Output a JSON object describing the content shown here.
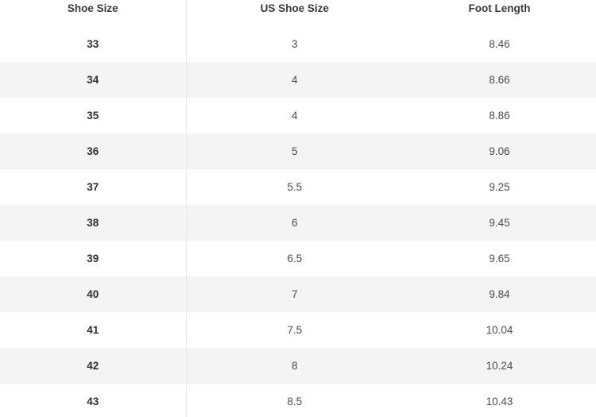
{
  "table": {
    "headers": [
      "Shoe Size",
      "US Shoe Size",
      "Foot Length"
    ],
    "rows": [
      [
        "33",
        "3",
        "8.46"
      ],
      [
        "34",
        "4",
        "8.66"
      ],
      [
        "35",
        "4",
        "8.86"
      ],
      [
        "36",
        "5",
        "9.06"
      ],
      [
        "37",
        "5.5",
        "9.25"
      ],
      [
        "38",
        "6",
        "9.45"
      ],
      [
        "39",
        "6.5",
        "9.65"
      ],
      [
        "40",
        "7",
        "9.84"
      ],
      [
        "41",
        "7.5",
        "10.04"
      ],
      [
        "42",
        "8",
        "10.24"
      ],
      [
        "43",
        "8.5",
        "10.43"
      ]
    ]
  }
}
